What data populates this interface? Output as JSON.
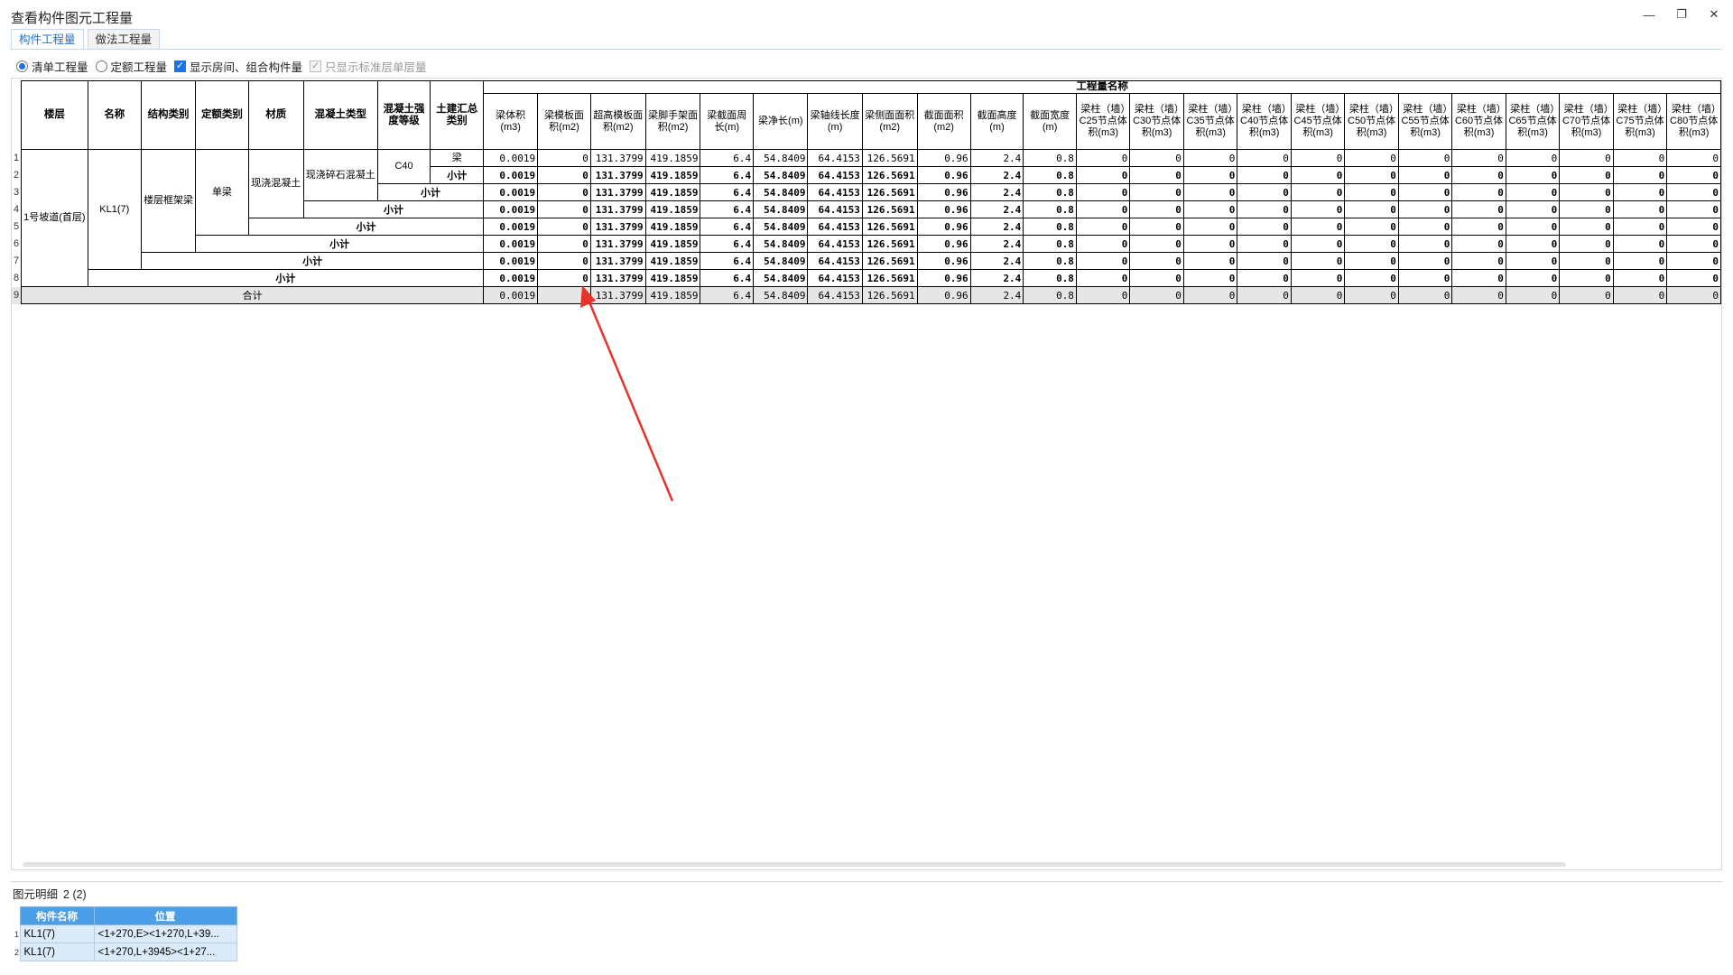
{
  "window": {
    "title": "查看构件图元工程量",
    "buttons": {
      "minimize": "—",
      "restore": "❐",
      "close": "✕"
    }
  },
  "tabs": [
    {
      "label": "构件工程量",
      "active": true
    },
    {
      "label": "做法工程量",
      "active": false
    }
  ],
  "options": {
    "qingdan": {
      "label": "清单工程量",
      "checked": true
    },
    "dinge": {
      "label": "定额工程量",
      "checked": false
    },
    "show_room": {
      "label": "显示房间、组合构件量",
      "checked": true
    },
    "std_only": {
      "label": "只显示标准层单层量",
      "checked": true,
      "disabled": true
    }
  },
  "grid": {
    "group_header": "工程量名称",
    "headers": {
      "floor": "楼层",
      "name": "名称",
      "struct_type": "结构类别",
      "quota_type": "定额类别",
      "material": "材质",
      "concrete_type": "混凝土类型",
      "concrete_grade": "混凝土强度等级",
      "civil_type": "土建汇总类别"
    },
    "metric_headers": [
      "梁体积(m3)",
      "梁模板面积(m2)",
      "超高模板面积(m2)",
      "梁脚手架面积(m2)",
      "梁截面周长(m)",
      "梁净长(m)",
      "梁轴线长度(m)",
      "梁侧面面积(m2)",
      "截面面积(m2)",
      "截面高度(m)",
      "截面宽度(m)",
      "梁柱（墙）C25节点体积(m3)",
      "梁柱（墙）C30节点体积(m3)",
      "梁柱（墙）C35节点体积(m3)",
      "梁柱（墙）C40节点体积(m3)",
      "梁柱（墙）C45节点体积(m3)",
      "梁柱（墙）C50节点体积(m3)",
      "梁柱（墙）C55节点体积(m3)",
      "梁柱（墙）C60节点体积(m3)",
      "梁柱（墙）C65节点体积(m3)",
      "梁柱（墙）C70节点体积(m3)",
      "梁柱（墙）C75节点体积(m3)",
      "梁柱（墙）C80节点体积(m3)"
    ],
    "cells": {
      "floor": "1号坡道(首层)",
      "name": "KL1(7)",
      "struct_type": "楼层框架梁",
      "quota_type": "单梁",
      "material": "现浇混凝土",
      "concrete_type": "现浇碎石混凝土",
      "concrete_grade": "C40",
      "civil_type": "梁"
    },
    "subtotal_label": "小计",
    "total_label": "合计",
    "row_numbers": [
      "1",
      "2",
      "3",
      "4",
      "5",
      "6",
      "7",
      "8",
      "9"
    ],
    "values": [
      "0.0019",
      "0",
      "131.3799",
      "419.1859",
      "6.4",
      "54.8409",
      "64.4153",
      "126.5691",
      "0.96",
      "2.4",
      "0.8",
      "0",
      "0",
      "0",
      "0",
      "0",
      "0",
      "0",
      "0",
      "0",
      "0",
      "0",
      "0"
    ]
  },
  "detail": {
    "label": "图元明细",
    "count": "2 (2)",
    "headers": {
      "name": "构件名称",
      "position": "位置"
    },
    "rows": [
      {
        "num": "1",
        "name": "KL1(7)",
        "position": "<1+270,E><1+270,L+39..."
      },
      {
        "num": "2",
        "name": "KL1(7)",
        "position": "<1+270,L+3945><1+27..."
      }
    ]
  },
  "colors": {
    "accent": "#1a73e8",
    "tab_active_text": "#1e73d2",
    "total_row_bg": "#e6e6e6",
    "detail_header_bg": "#4a9fe8",
    "detail_row_bg": "#dcebfa",
    "annotation_arrow": "#e8332a"
  }
}
